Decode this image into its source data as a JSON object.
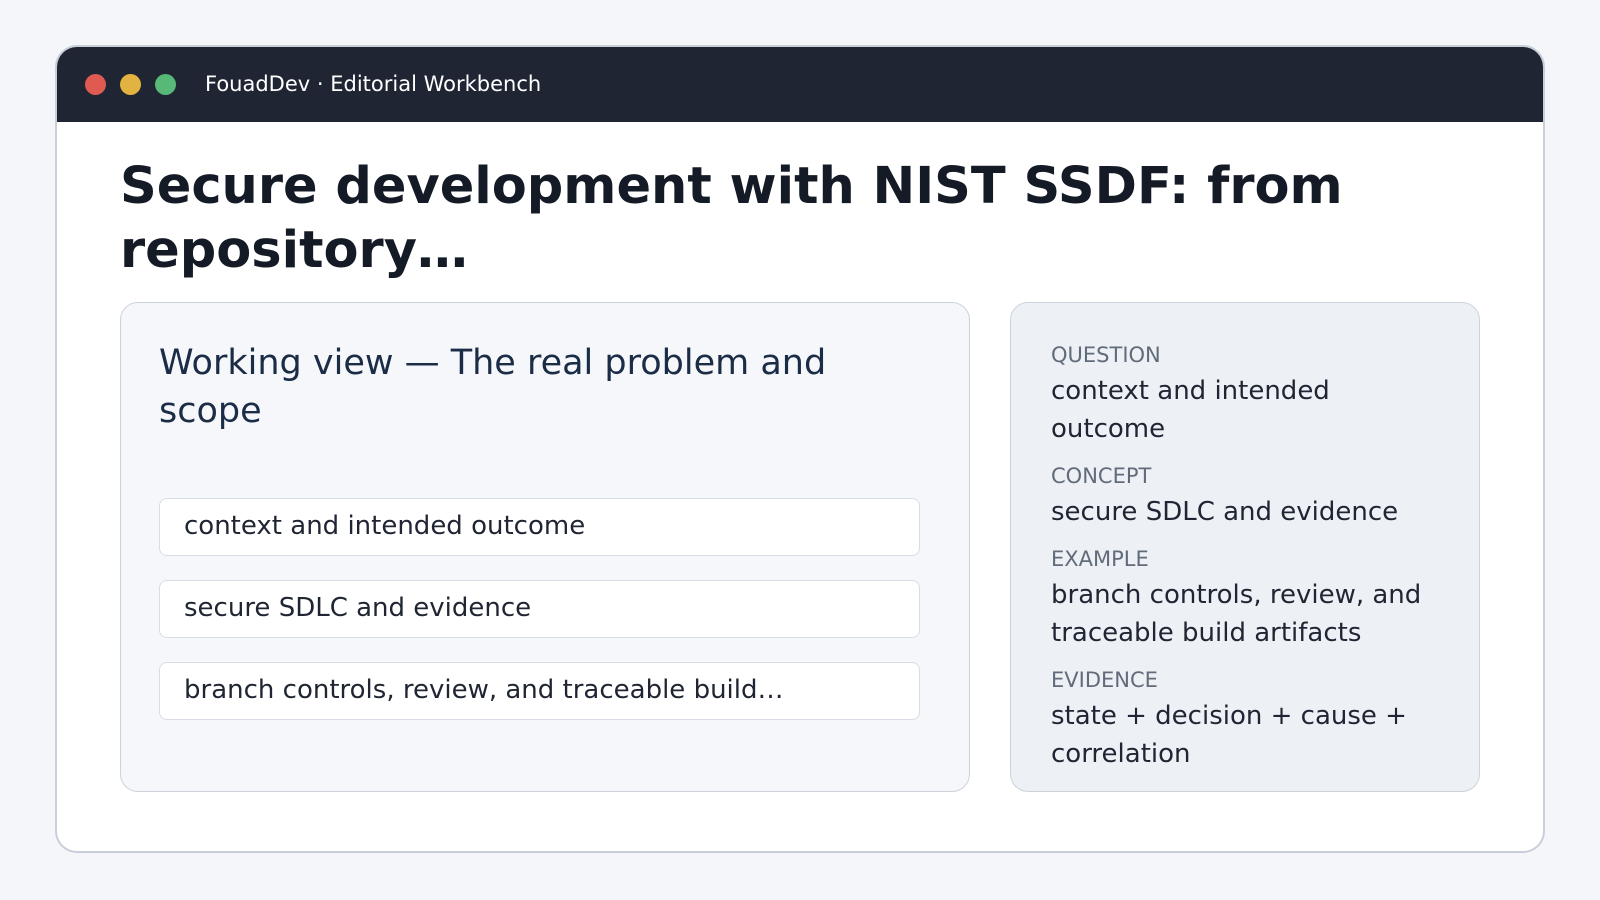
{
  "window": {
    "title": "FouadDev · Editorial Workbench"
  },
  "page": {
    "title": "Secure development with NIST SSDF: from repository…"
  },
  "working_view": {
    "title": "Working view — The real problem and scope",
    "items": [
      "context and intended outcome",
      "secure SDLC and evidence",
      "branch controls, review, and traceable build…"
    ]
  },
  "details": [
    {
      "label": "QUESTION",
      "value": "context and intended outcome"
    },
    {
      "label": "CONCEPT",
      "value": "secure SDLC and evidence"
    },
    {
      "label": "EXAMPLE",
      "value": "branch controls, review, and traceable build artifacts"
    },
    {
      "label": "EVIDENCE",
      "value": "state + decision + cause + correlation"
    }
  ],
  "colors": {
    "titlebar": "#1f2532",
    "close": "#df5b52",
    "minimize": "#e2b341",
    "maximize": "#58b877"
  }
}
